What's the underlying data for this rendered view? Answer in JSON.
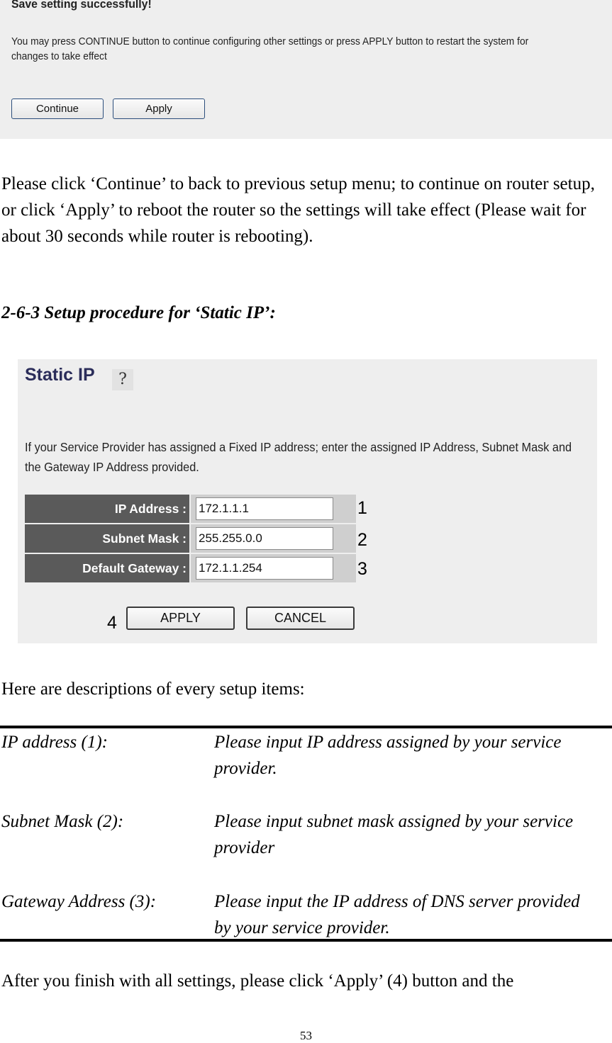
{
  "save_dialog": {
    "title": "Save setting successfully!",
    "message": "You may press CONTINUE button to continue configuring other settings or press APPLY button to restart the system for changes to take effect",
    "continue_label": "Continue",
    "apply_label": "Apply"
  },
  "paragraph1": "Please click ‘Continue’ to back to previous setup menu; to continue on router setup, or click ‘Apply’ to reboot the router so the settings will take effect (Please wait for about 30 seconds while router is rebooting).",
  "section_heading": "2-6-3 Setup procedure for ‘Static IP’:",
  "static_ip": {
    "title": "Static IP",
    "help_icon": "?",
    "description": "If your Service Provider has assigned a Fixed IP address; enter the assigned IP Address, Subnet Mask and the Gateway IP Address provided.",
    "fields": [
      {
        "label": "IP Address :",
        "value": "172.1.1.1",
        "callout": "1"
      },
      {
        "label": "Subnet Mask :",
        "value": "255.255.0.0",
        "callout": "2"
      },
      {
        "label": "Default Gateway :",
        "value": "172.1.1.254",
        "callout": "3"
      }
    ],
    "apply_label": "APPLY",
    "cancel_label": "CANCEL",
    "apply_callout": "4"
  },
  "paragraph2": "Here are descriptions of every setup items:",
  "descriptions": [
    {
      "term": "IP address (1):",
      "definition": "Please input IP address assigned by your service provider."
    },
    {
      "term": "Subnet Mask (2):",
      "definition": "Please input subnet mask assigned by your service provider"
    },
    {
      "term": "Gateway Address (3):",
      "definition": "Please input the IP address of DNS server provided by your service provider."
    }
  ],
  "paragraph3": "After you finish with all settings, please click ‘Apply’ (4) button and the",
  "page_number": "53"
}
